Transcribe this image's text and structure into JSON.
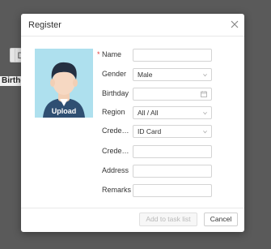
{
  "background": {
    "button_a": "D",
    "label_birthday": "Birthd"
  },
  "dialog": {
    "title": "Register",
    "upload_label": "Upload",
    "fields": {
      "name": {
        "label": "Name",
        "value": ""
      },
      "gender": {
        "label": "Gender",
        "value": "Male"
      },
      "birthday": {
        "label": "Birthday",
        "value": ""
      },
      "region": {
        "label": "Region",
        "value": "All / All"
      },
      "credential_type": {
        "label": "Credenti...",
        "value": "ID Card"
      },
      "credential_no": {
        "label": "Credenti...",
        "value": ""
      },
      "address": {
        "label": "Address",
        "value": ""
      },
      "remarks": {
        "label": "Remarks",
        "value": ""
      }
    },
    "buttons": {
      "add": "Add to task list",
      "cancel": "Cancel"
    }
  },
  "colors": {
    "required": "#e23b3b",
    "avatar_bg": "#aee0ee",
    "overlay": "#5a5a5a"
  }
}
